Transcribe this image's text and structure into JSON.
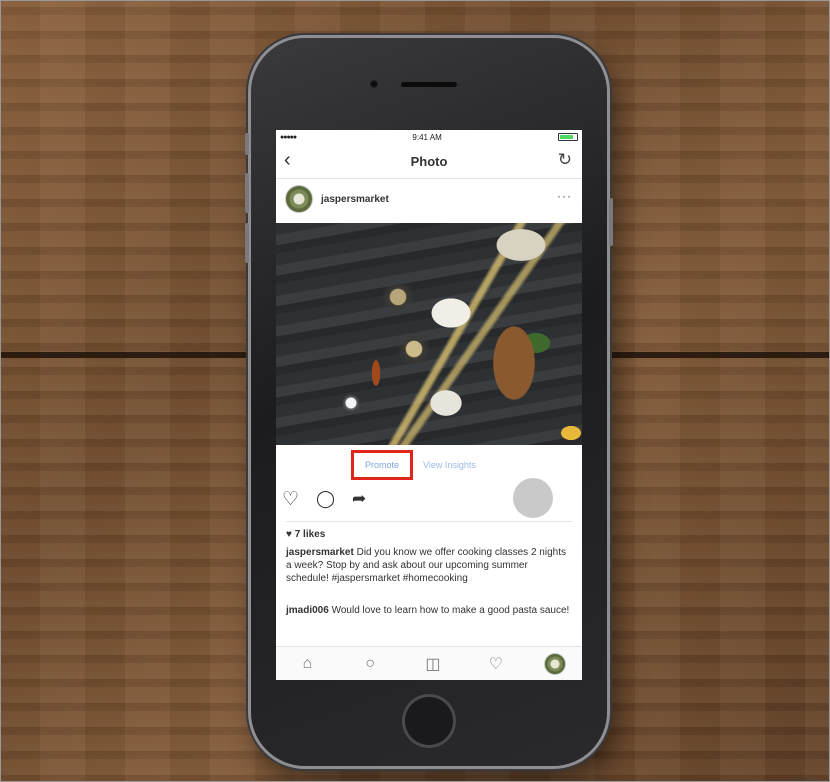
{
  "status_bar": {
    "signal": "●●●●●",
    "time": "9:41 AM"
  },
  "nav": {
    "title": "Photo",
    "back_glyph": "‹",
    "refresh_glyph": "↻"
  },
  "post": {
    "username": "jaspersmarket",
    "more_glyph": "···",
    "promote_label": "Promote",
    "insights_label": "View Insights",
    "likes": "♥ 7 likes",
    "caption_user": "jaspersmarket",
    "caption_text": " Did you know we offer cooking classes 2 nights a week? Stop by and ask about our upcoming summer schedule! #jaspersmarket #homecooking",
    "comment_user": "jmadi006",
    "comment_text": " Would love to learn how to make a good pasta sauce!"
  },
  "actions": {
    "like_glyph": "♡",
    "comment_glyph": "◯",
    "share_glyph": "➦"
  },
  "tabbar": {
    "home_glyph": "⌂",
    "search_glyph": "○",
    "camera_glyph": "◫",
    "activity_glyph": "♡"
  },
  "colors": {
    "promote_border": "#e0261b",
    "link_blue": "#7aa6de"
  }
}
